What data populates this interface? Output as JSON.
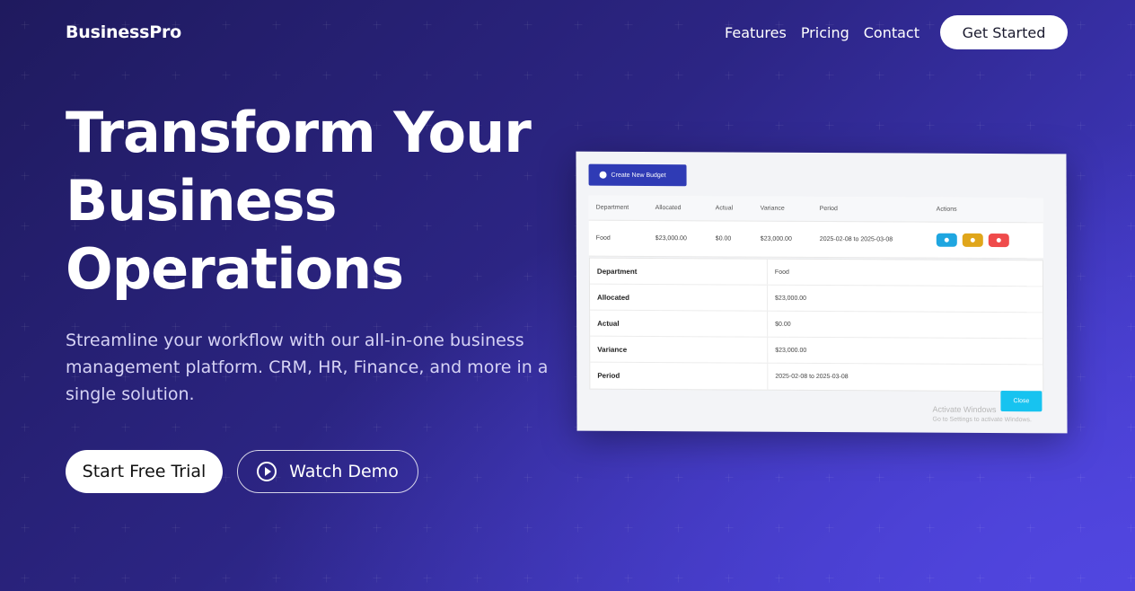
{
  "nav": {
    "brand": "BusinessPro",
    "links": [
      "Features",
      "Pricing",
      "Contact"
    ],
    "cta": "Get Started"
  },
  "hero": {
    "title_lines": [
      "Transform Your",
      "Business",
      "Operations"
    ],
    "subtitle": "Streamline your workflow with our all-in-one business management platform. CRM, HR, Finance, and more in a single solution.",
    "primary_cta": "Start Free Trial",
    "secondary_cta": "Watch Demo"
  },
  "screenshot": {
    "create_button": "Create New Budget",
    "table": {
      "headers": [
        "Department",
        "Allocated",
        "Actual",
        "Variance",
        "Period",
        "Actions"
      ],
      "rows": [
        [
          "Food",
          "$23,000.00",
          "$0.00",
          "$23,000.00",
          "2025-02-08 to 2025-03-08"
        ]
      ]
    },
    "detail": [
      {
        "key": "Department",
        "value": "Food"
      },
      {
        "key": "Allocated",
        "value": "$23,000.00"
      },
      {
        "key": "Actual",
        "value": "$0.00"
      },
      {
        "key": "Variance",
        "value": "$23,000.00"
      },
      {
        "key": "Period",
        "value": "2025-02-08 to 2025-03-08"
      }
    ],
    "close_button": "Close",
    "watermark": {
      "line1": "Activate Windows",
      "line2": "Go to Settings to activate Windows."
    }
  },
  "colors": {
    "accent": "#2f3bb5",
    "view_action": "#1fa6e0",
    "edit_action": "#e0a61b",
    "delete_action": "#ef4b4b",
    "close_button": "#17c3f0"
  },
  "icons": [
    "play-icon",
    "plus-circle-icon",
    "eye-icon",
    "pencil-icon",
    "trash-icon"
  ]
}
